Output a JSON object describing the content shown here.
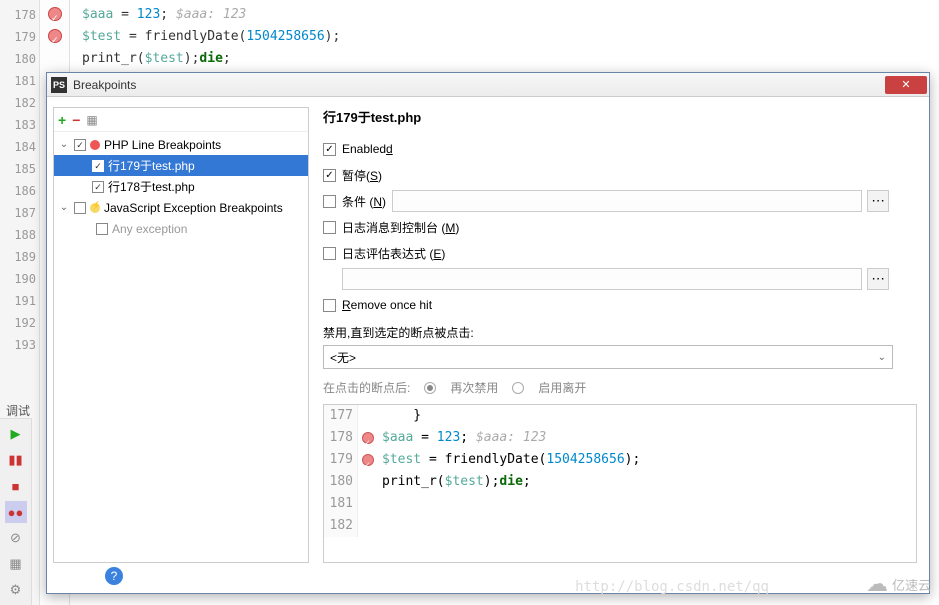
{
  "editor": {
    "lines": [
      {
        "num": "178",
        "bp": true,
        "html": "<span class='kw-var'>$aaa</span> = <span class='kw-num'>123</span>;   <span class='kw-comment'>$aaa: 123</span>"
      },
      {
        "num": "179",
        "bp": true,
        "html": "<span class='kw-var'>$test</span> = friendlyDate(<span class='kw-num'>1504258656</span>);"
      },
      {
        "num": "180",
        "bp": false,
        "html": "print_r(<span class='kw-var'>$test</span>);<span class='kw-die'>die</span>;"
      },
      {
        "num": "181",
        "bp": false,
        "html": ""
      },
      {
        "num": "182",
        "bp": false,
        "html": ""
      },
      {
        "num": "183",
        "bp": false,
        "html": ""
      },
      {
        "num": "184",
        "bp": false,
        "html": ""
      },
      {
        "num": "185",
        "bp": false,
        "html": ""
      },
      {
        "num": "186",
        "bp": false,
        "html": ""
      },
      {
        "num": "187",
        "bp": false,
        "html": ""
      },
      {
        "num": "188",
        "bp": false,
        "html": ""
      },
      {
        "num": "189",
        "bp": false,
        "html": ""
      },
      {
        "num": "190",
        "bp": false,
        "html": ""
      },
      {
        "num": "191",
        "bp": false,
        "html": ""
      },
      {
        "num": "192",
        "bp": false,
        "html": ""
      },
      {
        "num": "193",
        "bp": false,
        "html": ""
      }
    ]
  },
  "debug_tab": "调试",
  "dialog": {
    "title": "Breakpoints",
    "tree": {
      "php_group": "PHP Line Breakpoints",
      "bp1": "行179于test.php",
      "bp2": "行178于test.php",
      "js_group": "JavaScript Exception Breakpoints",
      "any": "Any exception"
    },
    "detail": {
      "title": "行179于test.php",
      "enabled": "Enabled",
      "enabled_u": "d",
      "suspend": "暂停(",
      "suspend_u": "S",
      "suspend_end": ")",
      "condition": "条件 (",
      "condition_u": "N",
      "condition_end": ")",
      "log_msg": "日志消息到控制台 (",
      "log_msg_u": "M",
      "log_msg_end": ")",
      "log_eval": "日志评估表达式 (",
      "log_eval_u": "E",
      "log_eval_end": ")",
      "remove": "Remove once hit",
      "remove_u": "R",
      "disable_until": "禁用,直到选定的断点被点击:",
      "none_option": "<无>",
      "after_hit": "在点击的断点后:",
      "radio1": "再次禁用",
      "radio2": "启用离开"
    },
    "preview": [
      {
        "num": "177",
        "bp": false,
        "html": "&nbsp;&nbsp;&nbsp;&nbsp;}"
      },
      {
        "num": "178",
        "bp": true,
        "html": "<span class='kw-var'>$aaa</span> = <span class='kw-num'>123</span>;   <span class='kw-comment'>$aaa: 123</span>"
      },
      {
        "num": "179",
        "bp": true,
        "html": "<span class='kw-var'>$test</span> = friendlyDate(<span class='kw-num'>1504258656</span>);"
      },
      {
        "num": "180",
        "bp": false,
        "html": "print_r(<span class='kw-var'>$test</span>);<span class='kw-die'>die</span>;"
      },
      {
        "num": "181",
        "bp": false,
        "html": ""
      },
      {
        "num": "182",
        "bp": false,
        "html": ""
      }
    ]
  },
  "watermark": "http://blog.csdn.net/qq",
  "cloud": "亿速云"
}
